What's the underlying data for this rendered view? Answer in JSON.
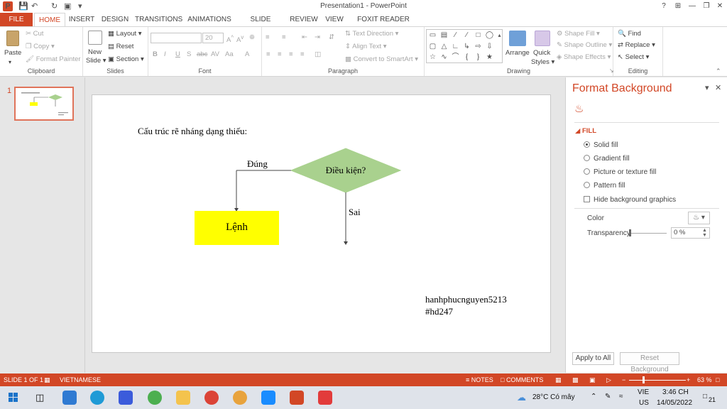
{
  "titlebar": {
    "title": "Presentation1 - PowerPoint",
    "help": "?",
    "minimize": "—",
    "restore": "❐",
    "close": "✕",
    "ribbon_display": "⊞"
  },
  "tabs": [
    "FILE",
    "HOME",
    "INSERT",
    "DESIGN",
    "TRANSITIONS",
    "ANIMATIONS",
    "SLIDE SHOW",
    "REVIEW",
    "VIEW",
    "FOXIT READER PDF"
  ],
  "ribbon": {
    "clipboard": {
      "label": "Clipboard",
      "paste": "Paste",
      "cut": "Cut",
      "copy": "Copy",
      "format_painter": "Format Painter"
    },
    "slides": {
      "label": "Slides",
      "new_slide_1": "New",
      "new_slide_2": "Slide",
      "layout": "Layout",
      "reset": "Reset",
      "section": "Section"
    },
    "font": {
      "label": "Font",
      "size": "20"
    },
    "paragraph": {
      "label": "Paragraph",
      "text_direction": "Text Direction",
      "align_text": "Align Text",
      "convert_smartart": "Convert to SmartArt"
    },
    "drawing": {
      "label": "Drawing",
      "arrange": "Arrange",
      "quick_styles_1": "Quick",
      "quick_styles_2": "Styles",
      "shape_fill": "Shape Fill",
      "shape_outline": "Shape Outline",
      "shape_effects": "Shape Effects"
    },
    "editing": {
      "label": "Editing",
      "find": "Find",
      "replace": "Replace",
      "select": "Select"
    }
  },
  "thumbs": {
    "slide_number": "1"
  },
  "slide": {
    "heading": "Cấu trúc rẽ nháng dạng thiếu:",
    "decision": "Điều kiện?",
    "yes_label": "Đúng",
    "no_label": "Sai",
    "action": "Lệnh",
    "watermark_1": "hanhphucnguyen5213",
    "watermark_2": "#hd247",
    "colors": {
      "decision_fill": "#a9d18e",
      "action_fill": "#ffff00"
    }
  },
  "pane": {
    "title": "Format Background",
    "section": "FILL",
    "options": [
      "Solid fill",
      "Gradient fill",
      "Picture or texture fill",
      "Pattern fill"
    ],
    "hide_graphics": "Hide background graphics",
    "color_label": "Color",
    "transparency_label": "Transparency",
    "transparency_value": "0 %",
    "apply_all": "Apply to All",
    "reset_background": "Reset Background"
  },
  "statusbar": {
    "slide": "SLIDE 1 OF 1",
    "language": "VIETNAMESE",
    "notes": "NOTES",
    "comments": "COMMENTS",
    "zoom": "63 %"
  },
  "taskbar": {
    "weather": "28°C Có mây",
    "lang_1": "VIE",
    "lang_2": "US",
    "time": "3:46 CH",
    "date": "14/05/2022",
    "notifications": "21"
  },
  "accent": "#d24726"
}
